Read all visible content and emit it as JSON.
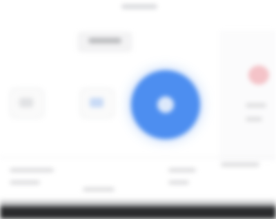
{
  "colors": {
    "accent": "#4d8ef0",
    "alert": "#f4c3c8",
    "bottom_bar": "#2a2b2d",
    "background": "#ffffff"
  },
  "icons": {
    "primary": "circle-action-icon",
    "left_tile": "tile-icon",
    "middle_tile": "tile-icon",
    "right_status": "status-dot-icon"
  }
}
